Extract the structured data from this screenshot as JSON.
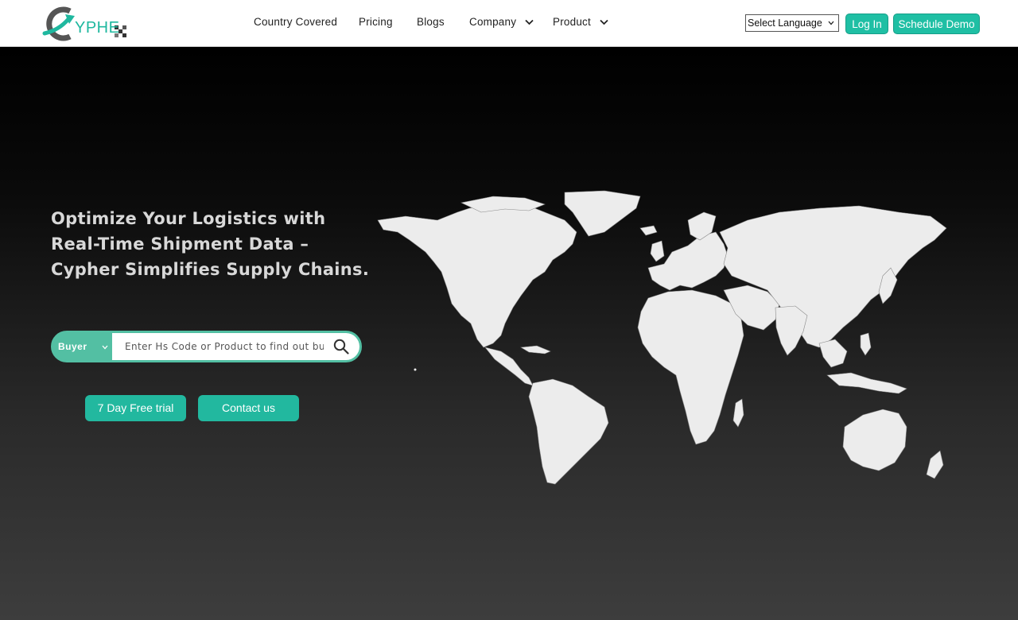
{
  "header": {
    "logo_text": "YPHE",
    "nav": [
      {
        "label": "Country Covered",
        "has_dropdown": false
      },
      {
        "label": "Pricing",
        "has_dropdown": false
      },
      {
        "label": "Blogs",
        "has_dropdown": false
      },
      {
        "label": "Company",
        "has_dropdown": true
      },
      {
        "label": "Product",
        "has_dropdown": true
      }
    ],
    "language_select": "Select Language",
    "login_label": "Log In",
    "demo_label": "Schedule Demo"
  },
  "hero": {
    "headline": "Optimize Your Logistics with Real-Time Shipment Data – Cypher Simplifies Supply Chains.",
    "search": {
      "type_selected": "Buyer",
      "placeholder": "Enter Hs Code or Product to find out buyers"
    },
    "trial_label": "7 Day Free trial",
    "contact_label": "Contact us"
  },
  "colors": {
    "accent": "#1fbfa4",
    "search_accent": "#53bfa3",
    "map_fill": "#ececec"
  },
  "icons": {
    "search": "search-icon",
    "dropdown": "chevron-down-icon",
    "logo": "cypher-logo-icon"
  }
}
